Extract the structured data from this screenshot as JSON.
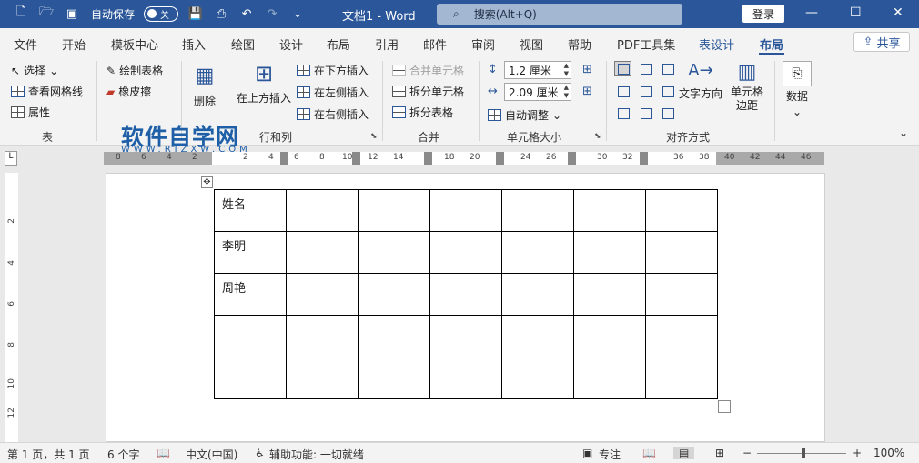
{
  "titlebar": {
    "autosave_label": "自动保存",
    "autosave_state": "关",
    "doc_title": "文档1 - Word",
    "search_placeholder": "搜索(Alt+Q)",
    "login_label": "登录"
  },
  "menu": {
    "items": [
      "文件",
      "开始",
      "模板中心",
      "插入",
      "绘图",
      "设计",
      "布局",
      "引用",
      "邮件",
      "审阅",
      "视图",
      "帮助",
      "PDF工具集",
      "表设计",
      "布局"
    ],
    "share_label": "共享"
  },
  "ribbon": {
    "select": "选择",
    "gridlines": "查看网格线",
    "properties": "属性",
    "draw_table": "绘制表格",
    "eraser": "橡皮擦",
    "delete": "删除",
    "insert_above": "在上方插入",
    "insert_below": "在下方插入",
    "insert_left": "在左侧插入",
    "insert_right": "在右侧插入",
    "merge_cells": "合并单元格",
    "split_cells": "拆分单元格",
    "split_table": "拆分表格",
    "height": "1.2 厘米",
    "width": "2.09 厘米",
    "autofit": "自动调整",
    "text_direction": "文字方向",
    "cell_margins": "单元格边距",
    "data": "数据",
    "groups": {
      "table": "表",
      "rows_cols": "行和列",
      "merge": "合并",
      "cell_size": "单元格大小",
      "alignment": "对齐方式"
    }
  },
  "watermark": {
    "main": "软件自学网",
    "sub": "WWW.RJZXW.COM"
  },
  "ruler": {
    "h_labels": [
      "8",
      "6",
      "4",
      "2",
      "2",
      "4",
      "6",
      "8",
      "10",
      "12",
      "14",
      "18",
      "20",
      "24",
      "26",
      "30",
      "32",
      "36",
      "38",
      "40",
      "42",
      "44",
      "46"
    ],
    "v_labels": [
      "2",
      "4",
      "6",
      "8",
      "10",
      "12"
    ]
  },
  "table": {
    "rows": [
      [
        "姓名",
        "",
        "",
        "",
        "",
        "",
        "",
        ""
      ],
      [
        "李明",
        "",
        "",
        "",
        "",
        "",
        "",
        ""
      ],
      [
        "周艳",
        "",
        "",
        "",
        "",
        "",
        "",
        ""
      ],
      [
        "",
        "",
        "",
        "",
        "",
        "",
        "",
        ""
      ],
      [
        "",
        "",
        "",
        "",
        "",
        "",
        "",
        ""
      ]
    ]
  },
  "status": {
    "page": "第 1 页，共 1 页",
    "words": "6 个字",
    "language": "中文(中国)",
    "accessibility": "辅助功能: 一切就绪",
    "focus": "专注",
    "zoom": "100%"
  },
  "colors": {
    "accent": "#2b579a",
    "watermark": "#1e5fa8"
  }
}
